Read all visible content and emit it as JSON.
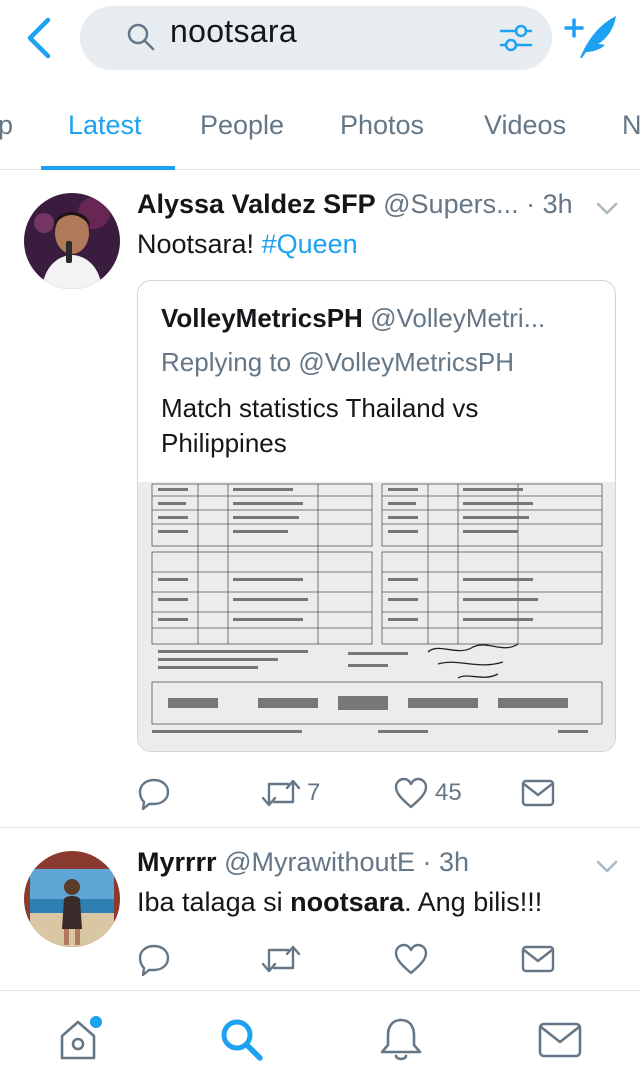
{
  "search": {
    "query": "nootsara"
  },
  "tabs": [
    {
      "label": "p"
    },
    {
      "label": "Latest"
    },
    {
      "label": "People"
    },
    {
      "label": "Photos"
    },
    {
      "label": "Videos"
    },
    {
      "label": "N"
    }
  ],
  "tweets": [
    {
      "name": "Alyssa Valdez SFP",
      "handle": "@Supers...",
      "time": "· 3h",
      "text_main": "Nootsara!",
      "text_hashtag": "#Queen",
      "quote": {
        "name": "VolleyMetricsPH",
        "handle": "@VolleyMetri...",
        "replying_prefix": "Replying to ",
        "replying_handle": "@VolleyMetricsPH",
        "text": "Match statistics Thailand vs Philippines"
      },
      "actions": {
        "replies": "",
        "retweets": "7",
        "likes": "45"
      }
    },
    {
      "name": "Myrrrr",
      "handle": "@MyrawithoutE",
      "time": "· 3h",
      "text_before": "Iba talaga si ",
      "text_bold": "nootsara",
      "text_after": ". Ang bilis!!!",
      "actions": {
        "replies": "",
        "retweets": "",
        "likes": ""
      }
    }
  ],
  "icons": {
    "back": "chevron-left-icon",
    "search": "magnifier-icon",
    "filter": "sliders-icon",
    "compose": "compose-feather-icon",
    "reply": "reply-bubble-icon",
    "retweet": "retweet-icon",
    "like": "heart-icon",
    "dm": "envelope-icon",
    "home": "home-icon",
    "explore": "search-icon",
    "notifications": "bell-icon",
    "messages": "envelope-icon"
  },
  "colors": {
    "accent": "#1da1f2",
    "secondary_text": "#657786",
    "primary_text": "#14171a",
    "search_bg": "#e6ecf0",
    "divider": "#e1e8ed"
  }
}
